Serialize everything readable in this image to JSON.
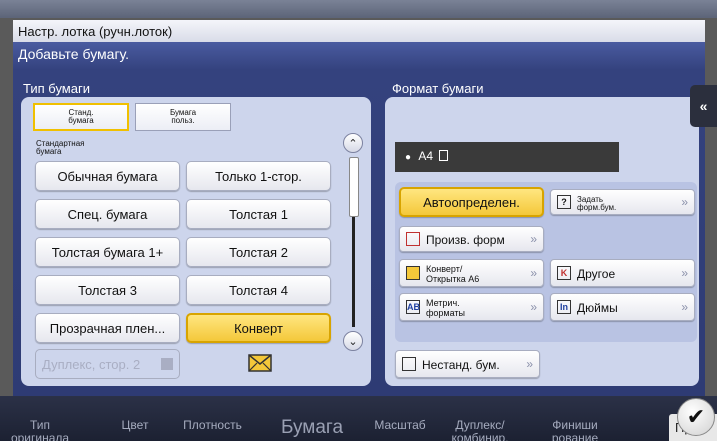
{
  "background_tabs": [
    {
      "label": "Тип\nоригинала"
    },
    {
      "label": "Цвет"
    },
    {
      "label": "Плотность"
    },
    {
      "label": "Бумага"
    },
    {
      "label": "Масштаб"
    },
    {
      "label": "Дуплекс/\nкомбинир."
    },
    {
      "label": "Финиши\nрование"
    }
  ],
  "background_button": "При",
  "dialog": {
    "title": "Настр. лотка (ручн.лоток)",
    "subtitle": "Добавьте бумагу."
  },
  "paper_type": {
    "label": "Тип бумаги",
    "tabs": [
      {
        "label": "Станд.\nбумага",
        "selected": true
      },
      {
        "label": "Бумага\nпольз.",
        "selected": false
      }
    ],
    "list_label": "Стандартная\nбумага",
    "buttons_left": [
      "Обычная бумага",
      "Спец. бумага",
      "Толстая бумага 1+",
      "Толстая 3",
      "Прозрачная плен..."
    ],
    "buttons_right": [
      "Только 1-стор.",
      "Толстая 1",
      "Толстая 2",
      "Толстая 4",
      "Конверт"
    ],
    "selected": "Конверт",
    "duplex_label": "Дуплекс, стор. 2",
    "envelope_icon": "envelope-icon"
  },
  "paper_format": {
    "label": "Формат бумаги",
    "display": "A4",
    "auto_label": "Автоопределен.",
    "set_format_label": "Задать\nформ.бум.",
    "custom_label": "Произв. форм",
    "envelope_label": "Конверт/\nОткрытка А6",
    "other_label": "Другое",
    "metric_label": "Метрич.\nформаты",
    "inch_label": "Дюймы",
    "nonstandard_label": "Нестанд. бум."
  },
  "colors": {
    "accent_selected": "#f4c83a",
    "dialog_bg": "#3a4a86",
    "panel_bg": "#cdd5ec"
  }
}
